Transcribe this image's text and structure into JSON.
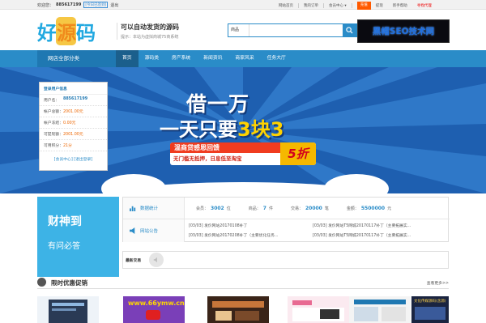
{
  "topbar": {
    "welcome": "欢迎您：",
    "user_id": "885617199",
    "sign_tag": "[今日已签到]",
    "logout": "退出",
    "links": [
      "网站首页",
      "我的订单",
      "会员中心 ▾"
    ],
    "highlight_btn": "充值",
    "extra": [
      "提现",
      "新手帮助"
    ],
    "recruit": "寻找代理"
  },
  "logo": {
    "part1": "好",
    "part2": "源",
    "part3": "码"
  },
  "slogan": {
    "title": "可以自动发货的源码",
    "sub": "提示：本站为虚拟商城75商系统"
  },
  "search": {
    "category": "商品",
    "placeholder": "",
    "button": "search"
  },
  "ad": {
    "text": "黑帽SEO技术网"
  },
  "nav": {
    "all_categories": "网店全部分类",
    "items": [
      "首页",
      "源码类",
      "房产系统",
      "新闻资讯",
      "商家风采",
      "任务大厅"
    ]
  },
  "login_panel": {
    "title": "登录用户信息",
    "rows": [
      {
        "k": "用户名：",
        "v": "885617199"
      },
      {
        "k": "帐户总额：",
        "v": "2001.00元"
      },
      {
        "k": "帐户冻结：",
        "v": "0.00元"
      },
      {
        "k": "可提现额：",
        "v": "2001.00元"
      },
      {
        "k": "可用积分：",
        "v": "21分"
      }
    ],
    "links": "[会员中心] [退出登录]"
  },
  "banner": {
    "line1": "借一万",
    "line2_a": "一天只要",
    "line2_b": "3块3",
    "promo_title": "温商贷感恩回馈",
    "promo_sub": "无门槛无抵押，日息低至淘宝",
    "discount": "5折"
  },
  "god_box": {
    "title": "财神到",
    "sub": "有问必答"
  },
  "stats": {
    "label_data": "数据统计",
    "label_notice": "网站公告",
    "items": [
      {
        "k": "会员：",
        "v": "3002",
        "u": "位"
      },
      {
        "k": "商品：",
        "v": "7",
        "u": "件"
      },
      {
        "k": "交易：",
        "v": "20000",
        "u": "笔"
      },
      {
        "k": "金额：",
        "v": "5500000",
        "u": "元"
      }
    ],
    "notices": [
      "[03/03] 发价网站20170108补丁",
      "[03/03] 发价网站T5网城20170117补丁（主要拓展实...",
      "[03/03] 发价网站20170208补丁（主要优化任务...",
      "[03/03] 发价网站T5网城20170117补丁（主要拓展实..."
    ]
  },
  "trade": {
    "label": "最新交易"
  },
  "section": {
    "title": "限时优惠促销",
    "more": "查看更多>>"
  },
  "products": [
    {
      "caption": ""
    },
    {
      "caption": "www.66ymw.cn"
    },
    {
      "caption": ""
    },
    {
      "caption": ""
    },
    {
      "caption": ""
    },
    {
      "caption": "文化传媒源码(含源)"
    }
  ],
  "colors": {
    "primary": "#2a8cc8",
    "nav_dark": "#1f78b2",
    "orange": "#ff5a00",
    "banner": "#1e5fb0"
  }
}
